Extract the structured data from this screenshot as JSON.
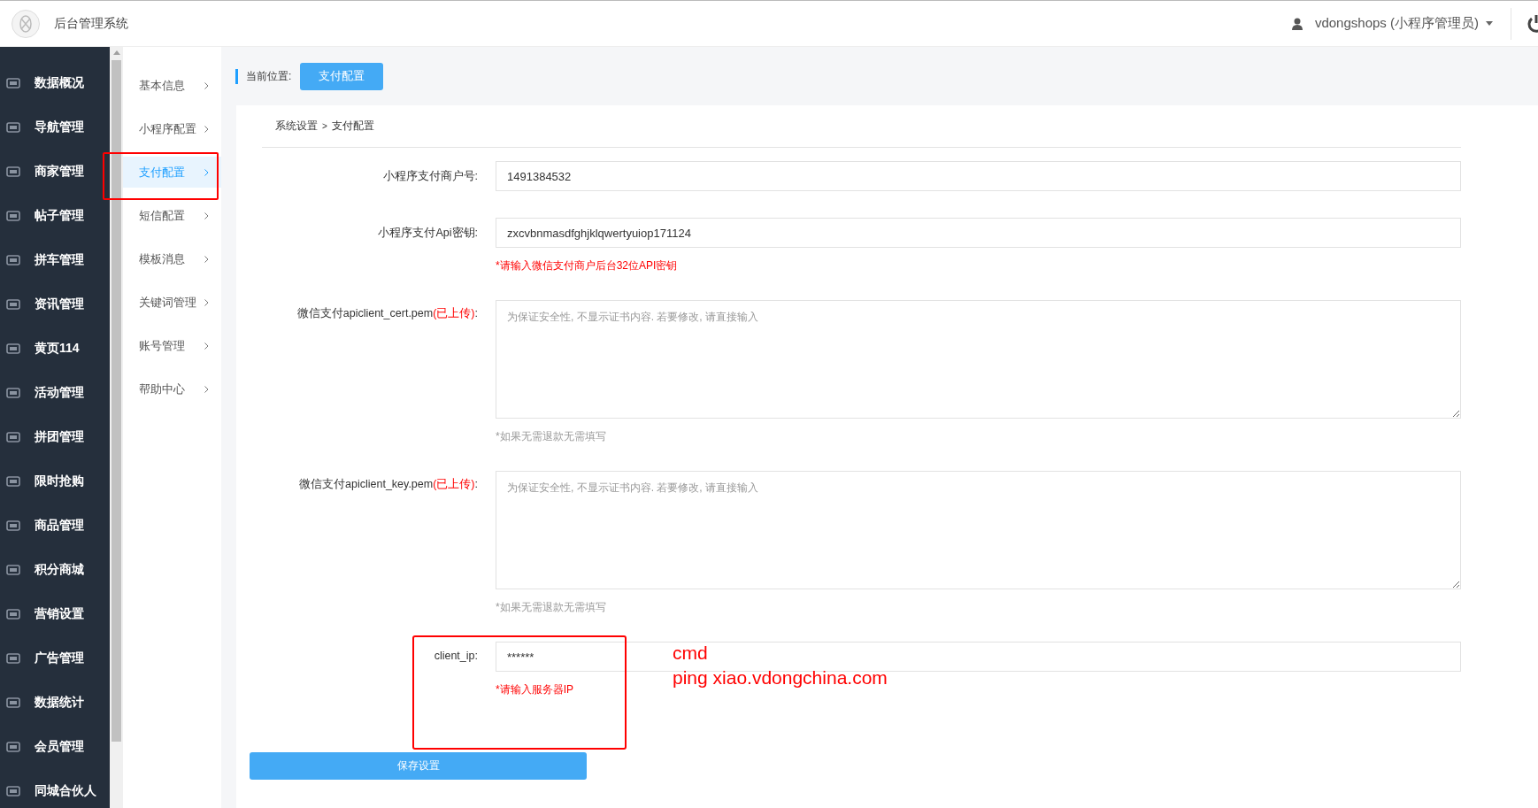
{
  "header": {
    "title": "后台管理系统",
    "user": "vdongshops (小程序管理员)"
  },
  "sidebar": {
    "items": [
      {
        "label": "数据概况",
        "selected": false
      },
      {
        "label": "导航管理",
        "selected": false
      },
      {
        "label": "商家管理",
        "selected": false
      },
      {
        "label": "帖子管理",
        "selected": false
      },
      {
        "label": "拼车管理",
        "selected": false
      },
      {
        "label": "资讯管理",
        "selected": false
      },
      {
        "label": "黄页114",
        "selected": false
      },
      {
        "label": "活动管理",
        "selected": false
      },
      {
        "label": "拼团管理",
        "selected": false
      },
      {
        "label": "限时抢购",
        "selected": false
      },
      {
        "label": "商品管理",
        "selected": false
      },
      {
        "label": "积分商城",
        "selected": false
      },
      {
        "label": "营销设置",
        "selected": false
      },
      {
        "label": "广告管理",
        "selected": false
      },
      {
        "label": "数据统计",
        "selected": false
      },
      {
        "label": "会员管理",
        "selected": false
      },
      {
        "label": "同城合伙人",
        "selected": false
      }
    ]
  },
  "submenu": {
    "items": [
      {
        "label": "基本信息",
        "selected": false
      },
      {
        "label": "小程序配置",
        "selected": false
      },
      {
        "label": "支付配置",
        "selected": true
      },
      {
        "label": "短信配置",
        "selected": false
      },
      {
        "label": "模板消息",
        "selected": false
      },
      {
        "label": "关键词管理",
        "selected": false
      },
      {
        "label": "账号管理",
        "selected": false
      },
      {
        "label": "帮助中心",
        "selected": false
      }
    ]
  },
  "location": {
    "label": "当前位置:",
    "current": "支付配置"
  },
  "breadcrumb": {
    "parent": "系统设置",
    "separator": ">",
    "current": "支付配置"
  },
  "form": {
    "fields": [
      {
        "kind": "input",
        "label": "小程序支付商户号:",
        "value": "1491384532"
      },
      {
        "kind": "input",
        "label": "小程序支付Api密钥:",
        "value": "zxcvbnmasdfghjklqwertyuiop171124",
        "hint": {
          "text": "*请输入微信支付商户后台32位API密钥",
          "color": "#ff0000"
        }
      },
      {
        "kind": "textarea",
        "label": "微信支付apiclient_cert.pem",
        "note": "(已上传)",
        "label_end": ":",
        "placeholder": "为保证安全性, 不显示证书内容. 若要修改, 请直接输入",
        "hint": {
          "text": "*如果无需退款无需填写",
          "color": "#999999"
        }
      },
      {
        "kind": "textarea",
        "label": "微信支付apiclient_key.pem",
        "note": "(已上传)",
        "label_end": ":",
        "placeholder": "为保证安全性, 不显示证书内容. 若要修改, 请直接输入",
        "hint": {
          "text": "*如果无需退款无需填写",
          "color": "#999999"
        }
      },
      {
        "kind": "input",
        "label": "client_ip:",
        "value": "******",
        "hint": {
          "text": "*请输入服务器IP",
          "color": "#ff0000"
        }
      }
    ],
    "save": "保存设置"
  },
  "annotations": {
    "lines": [
      "cmd",
      "ping xiao.vdongchina.com"
    ]
  }
}
